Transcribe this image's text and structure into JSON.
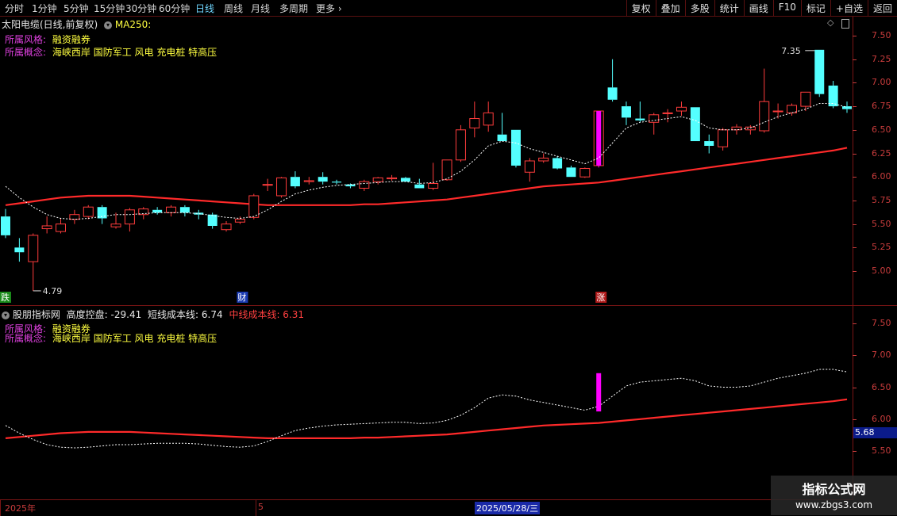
{
  "toolbar": {
    "left_items": [
      "分时",
      "1分钟",
      "5分钟",
      "15分钟",
      "30分钟",
      "60分钟",
      "日线",
      "周线",
      "月线",
      "多周期",
      "更多"
    ],
    "active": "日线",
    "more_arrow": "›",
    "right_items": [
      "复权",
      "叠加",
      "多股",
      "统计",
      "画线",
      "F10",
      "标记",
      "+自选",
      "返回"
    ]
  },
  "main_pane": {
    "title": "太阳电缆(日线,前复权)",
    "indicator": "MA250:",
    "style_label": "所属风格:",
    "style_value": "融资融券",
    "concept_label": "所属概念:",
    "concept_value": "海峡西岸 国防军工 风电 充电桩 特高压",
    "high_label": "7.35",
    "low_label": "4.79",
    "markers": [
      "跌",
      "财",
      "涨"
    ],
    "y_ticks": [
      "7.50",
      "7.25",
      "7.00",
      "6.75",
      "6.50",
      "6.25",
      "6.00",
      "5.75",
      "5.50",
      "5.25",
      "5.00"
    ]
  },
  "sub_pane": {
    "title": "股朋指标网",
    "metric1": "高度控盘: -29.41",
    "metric2": "短线成本线: 6.74",
    "metric3": "中线成本线: 6.31",
    "style_label": "所属风格:",
    "style_value": "融资融券",
    "concept_label": "所属概念:",
    "concept_value": "海峡西岸 国防军工 风电 充电桩 特高压",
    "y_ticks": [
      "7.50",
      "7.00",
      "6.50",
      "6.00",
      "5.50"
    ],
    "cursor_value": "5.68"
  },
  "bottom_bar": {
    "year_label": "2025年",
    "month_label": "5",
    "date_label": "2025/05/28/三"
  },
  "watermark": {
    "line1": "指标公式网",
    "line2": "www.zbgs3.com"
  },
  "colors": {
    "up": "#ff3c3c",
    "down": "#54ffff",
    "ma250": "#ff2a2a",
    "ma_short": "#ffffff",
    "accent": "#ff00ff"
  },
  "chart_data": {
    "type": "candlestick",
    "title": "太阳电缆(日线,前复权)",
    "ylim": [
      4.7,
      7.55
    ],
    "candles": [
      {
        "o": 5.58,
        "h": 5.66,
        "l": 5.35,
        "c": 5.38
      },
      {
        "o": 5.25,
        "h": 5.35,
        "l": 5.1,
        "c": 5.2
      },
      {
        "o": 5.1,
        "h": 5.4,
        "l": 4.79,
        "c": 5.38
      },
      {
        "o": 5.45,
        "h": 5.58,
        "l": 5.4,
        "c": 5.48
      },
      {
        "o": 5.42,
        "h": 5.56,
        "l": 5.4,
        "c": 5.5
      },
      {
        "o": 5.55,
        "h": 5.65,
        "l": 5.5,
        "c": 5.6
      },
      {
        "o": 5.58,
        "h": 5.7,
        "l": 5.55,
        "c": 5.68
      },
      {
        "o": 5.68,
        "h": 5.7,
        "l": 5.5,
        "c": 5.56
      },
      {
        "o": 5.47,
        "h": 5.62,
        "l": 5.45,
        "c": 5.5
      },
      {
        "o": 5.5,
        "h": 5.67,
        "l": 5.42,
        "c": 5.65
      },
      {
        "o": 5.6,
        "h": 5.68,
        "l": 5.55,
        "c": 5.66
      },
      {
        "o": 5.65,
        "h": 5.68,
        "l": 5.6,
        "c": 5.62
      },
      {
        "o": 5.62,
        "h": 5.7,
        "l": 5.58,
        "c": 5.68
      },
      {
        "o": 5.68,
        "h": 5.7,
        "l": 5.58,
        "c": 5.62
      },
      {
        "o": 5.62,
        "h": 5.65,
        "l": 5.55,
        "c": 5.6
      },
      {
        "o": 5.6,
        "h": 5.62,
        "l": 5.45,
        "c": 5.48
      },
      {
        "o": 5.44,
        "h": 5.53,
        "l": 5.42,
        "c": 5.5
      },
      {
        "o": 5.52,
        "h": 5.58,
        "l": 5.5,
        "c": 5.55
      },
      {
        "o": 5.57,
        "h": 5.82,
        "l": 5.55,
        "c": 5.8
      },
      {
        "o": 5.92,
        "h": 5.98,
        "l": 5.85,
        "c": 5.92
      },
      {
        "o": 5.8,
        "h": 6.0,
        "l": 5.78,
        "c": 5.99
      },
      {
        "o": 6.0,
        "h": 6.06,
        "l": 5.88,
        "c": 5.9
      },
      {
        "o": 5.95,
        "h": 6.0,
        "l": 5.92,
        "c": 5.96
      },
      {
        "o": 6.0,
        "h": 6.05,
        "l": 5.92,
        "c": 5.95
      },
      {
        "o": 5.95,
        "h": 5.97,
        "l": 5.92,
        "c": 5.94
      },
      {
        "o": 5.92,
        "h": 5.93,
        "l": 5.88,
        "c": 5.9
      },
      {
        "o": 5.88,
        "h": 5.97,
        "l": 5.85,
        "c": 5.95
      },
      {
        "o": 5.95,
        "h": 6.0,
        "l": 5.92,
        "c": 5.99
      },
      {
        "o": 5.98,
        "h": 6.02,
        "l": 5.96,
        "c": 5.99
      },
      {
        "o": 5.99,
        "h": 6.0,
        "l": 5.95,
        "c": 5.95
      },
      {
        "o": 5.92,
        "h": 5.98,
        "l": 5.88,
        "c": 5.88
      },
      {
        "o": 5.88,
        "h": 6.15,
        "l": 5.86,
        "c": 5.93
      },
      {
        "o": 5.97,
        "h": 6.18,
        "l": 5.96,
        "c": 6.18
      },
      {
        "o": 6.18,
        "h": 6.55,
        "l": 6.16,
        "c": 6.5
      },
      {
        "o": 6.52,
        "h": 6.8,
        "l": 6.42,
        "c": 6.62
      },
      {
        "o": 6.55,
        "h": 6.8,
        "l": 6.48,
        "c": 6.68
      },
      {
        "o": 6.45,
        "h": 6.68,
        "l": 6.42,
        "c": 6.38
      },
      {
        "o": 6.5,
        "h": 6.5,
        "l": 6.1,
        "c": 6.12
      },
      {
        "o": 6.05,
        "h": 6.2,
        "l": 5.95,
        "c": 6.17
      },
      {
        "o": 6.17,
        "h": 6.25,
        "l": 6.15,
        "c": 6.2
      },
      {
        "o": 6.2,
        "h": 6.22,
        "l": 6.08,
        "c": 6.09
      },
      {
        "o": 6.1,
        "h": 6.12,
        "l": 6.0,
        "c": 6.0
      },
      {
        "o": 6.0,
        "h": 6.1,
        "l": 5.99,
        "c": 6.09
      },
      {
        "o": 6.12,
        "h": 6.7,
        "l": 6.1,
        "c": 6.7
      },
      {
        "o": 6.95,
        "h": 7.25,
        "l": 6.8,
        "c": 6.82
      },
      {
        "o": 6.75,
        "h": 6.8,
        "l": 6.55,
        "c": 6.63
      },
      {
        "o": 6.62,
        "h": 6.8,
        "l": 6.58,
        "c": 6.6
      },
      {
        "o": 6.58,
        "h": 6.68,
        "l": 6.45,
        "c": 6.66
      },
      {
        "o": 6.68,
        "h": 6.72,
        "l": 6.58,
        "c": 6.68
      },
      {
        "o": 6.7,
        "h": 6.8,
        "l": 6.65,
        "c": 6.74
      },
      {
        "o": 6.74,
        "h": 6.74,
        "l": 6.38,
        "c": 6.38
      },
      {
        "o": 6.38,
        "h": 6.45,
        "l": 6.25,
        "c": 6.33
      },
      {
        "o": 6.32,
        "h": 6.52,
        "l": 6.28,
        "c": 6.5
      },
      {
        "o": 6.5,
        "h": 6.56,
        "l": 6.45,
        "c": 6.53
      },
      {
        "o": 6.5,
        "h": 6.55,
        "l": 6.45,
        "c": 6.53
      },
      {
        "o": 6.49,
        "h": 7.15,
        "l": 6.47,
        "c": 6.8
      },
      {
        "o": 6.7,
        "h": 6.78,
        "l": 6.62,
        "c": 6.7
      },
      {
        "o": 6.68,
        "h": 6.78,
        "l": 6.65,
        "c": 6.76
      },
      {
        "o": 6.75,
        "h": 6.9,
        "l": 6.7,
        "c": 6.9
      },
      {
        "o": 7.35,
        "h": 7.35,
        "l": 6.85,
        "c": 6.88
      },
      {
        "o": 6.97,
        "h": 7.02,
        "l": 6.73,
        "c": 6.75
      },
      {
        "o": 6.75,
        "h": 6.8,
        "l": 6.68,
        "c": 6.72
      }
    ],
    "limit_up_index": 43,
    "ma_short": [
      5.9,
      5.78,
      5.68,
      5.6,
      5.56,
      5.55,
      5.56,
      5.58,
      5.6,
      5.6,
      5.61,
      5.62,
      5.62,
      5.62,
      5.61,
      5.59,
      5.57,
      5.56,
      5.58,
      5.65,
      5.74,
      5.82,
      5.86,
      5.89,
      5.91,
      5.92,
      5.93,
      5.94,
      5.95,
      5.95,
      5.93,
      5.94,
      5.98,
      6.06,
      6.18,
      6.33,
      6.38,
      6.36,
      6.3,
      6.26,
      6.22,
      6.18,
      6.14,
      6.2,
      6.36,
      6.52,
      6.58,
      6.6,
      6.62,
      6.64,
      6.6,
      6.52,
      6.5,
      6.5,
      6.52,
      6.58,
      6.64,
      6.68,
      6.72,
      6.78,
      6.78,
      6.74
    ],
    "ma250": [
      5.7,
      5.72,
      5.74,
      5.76,
      5.78,
      5.79,
      5.8,
      5.8,
      5.8,
      5.8,
      5.79,
      5.78,
      5.77,
      5.76,
      5.75,
      5.74,
      5.73,
      5.72,
      5.71,
      5.7,
      5.7,
      5.7,
      5.7,
      5.7,
      5.7,
      5.7,
      5.71,
      5.71,
      5.72,
      5.73,
      5.74,
      5.75,
      5.76,
      5.78,
      5.8,
      5.82,
      5.84,
      5.86,
      5.88,
      5.9,
      5.91,
      5.92,
      5.93,
      5.94,
      5.96,
      5.98,
      6.0,
      6.02,
      6.04,
      6.06,
      6.08,
      6.1,
      6.12,
      6.14,
      6.16,
      6.18,
      6.2,
      6.22,
      6.24,
      6.26,
      6.28,
      6.31
    ]
  }
}
